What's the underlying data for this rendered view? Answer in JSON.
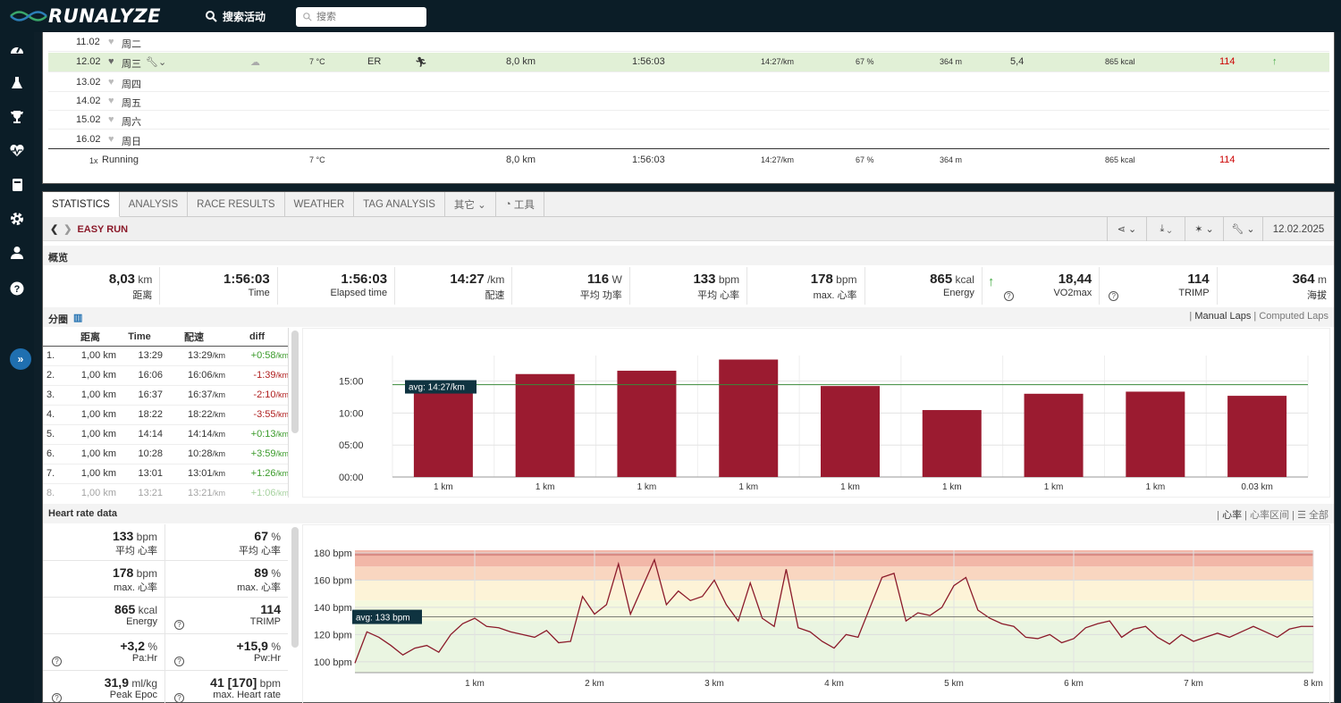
{
  "app": {
    "logo": "RUNALYZE",
    "search_activities": "搜索活动",
    "search_placeholder": "搜索"
  },
  "sidebar_icons": [
    "dashboard-icon",
    "flask-icon",
    "trophy-icon",
    "heartbeat-icon",
    "book-icon",
    "gear-icon",
    "user-icon",
    "help-icon"
  ],
  "week": {
    "rows": [
      {
        "date": "11.02",
        "day": "周二"
      },
      {
        "date": "12.02",
        "day": "周三",
        "temp": "7 °C",
        "type": "ER",
        "dist": "8,0 km",
        "time": "1:56:03",
        "pace": "14:27/km",
        "hrpct": "67 %",
        "elev": "364 m",
        "vo2": "5,4",
        "energy": "865 kcal",
        "trimp": "114"
      },
      {
        "date": "13.02",
        "day": "周四"
      },
      {
        "date": "14.02",
        "day": "周五"
      },
      {
        "date": "15.02",
        "day": "周六"
      },
      {
        "date": "16.02",
        "day": "周日"
      }
    ],
    "summary": {
      "count": "1x",
      "sport": "Running",
      "temp": "7 °C",
      "dist": "8,0 km",
      "time": "1:56:03",
      "pace": "14:27/km",
      "hrpct": "67 %",
      "elev": "364 m",
      "energy": "865 kcal",
      "trimp": "114"
    }
  },
  "tabs": [
    "STATISTICS",
    "ANALYSIS",
    "RACE RESULTS",
    "WEATHER",
    "TAG ANALYSIS",
    "其它",
    "工具"
  ],
  "activity": {
    "title": "EASY RUN",
    "date": "12.02.2025"
  },
  "overview": {
    "heading": "概览",
    "items": [
      {
        "value": "8,03",
        "unit": "km",
        "label": "距离"
      },
      {
        "value": "1:56:03",
        "unit": "",
        "label": "Time"
      },
      {
        "value": "1:56:03",
        "unit": "",
        "label": "Elapsed time"
      },
      {
        "value": "14:27",
        "unit": "/km",
        "label": "配速"
      },
      {
        "value": "116",
        "unit": "W",
        "label": "平均 功率"
      },
      {
        "value": "133",
        "unit": "bpm",
        "label": "平均 心率"
      },
      {
        "value": "178",
        "unit": "bpm",
        "label": "max. 心率"
      },
      {
        "value": "865",
        "unit": "kcal",
        "label": "Energy"
      },
      {
        "value": "18,44",
        "unit": "",
        "label": "VO2max"
      },
      {
        "value": "114",
        "unit": "",
        "label": "TRIMP"
      },
      {
        "value": "364",
        "unit": "m",
        "label": "海拔"
      }
    ]
  },
  "laps": {
    "heading": "分圈",
    "manual": "Manual Laps",
    "computed": "Computed Laps",
    "columns": [
      "距离",
      "Time",
      "配速",
      "diff"
    ],
    "rows": [
      {
        "n": "1.",
        "dist": "1,00 km",
        "time": "13:29",
        "pace": "13:29",
        "diff": "+0:58"
      },
      {
        "n": "2.",
        "dist": "1,00 km",
        "time": "16:06",
        "pace": "16:06",
        "diff": "-1:39"
      },
      {
        "n": "3.",
        "dist": "1,00 km",
        "time": "16:37",
        "pace": "16:37",
        "diff": "-2:10"
      },
      {
        "n": "4.",
        "dist": "1,00 km",
        "time": "18:22",
        "pace": "18:22",
        "diff": "-3:55"
      },
      {
        "n": "5.",
        "dist": "1,00 km",
        "time": "14:14",
        "pace": "14:14",
        "diff": "+0:13"
      },
      {
        "n": "6.",
        "dist": "1,00 km",
        "time": "10:28",
        "pace": "10:28",
        "diff": "+3:59"
      },
      {
        "n": "7.",
        "dist": "1,00 km",
        "time": "13:01",
        "pace": "13:01",
        "diff": "+1:26"
      },
      {
        "n": "8.",
        "dist": "1,00 km",
        "time": "13:21",
        "pace": "13:21",
        "diff": "+1:06"
      }
    ],
    "pace_unit": "/km",
    "diff_unit": "/km"
  },
  "chart_data": [
    {
      "type": "bar",
      "categories": [
        "1 km",
        "1 km",
        "1 km",
        "1 km",
        "1 km",
        "1 km",
        "1 km",
        "1 km",
        "0.03 km"
      ],
      "values": [
        13.48,
        16.1,
        16.62,
        18.37,
        14.23,
        10.47,
        13.02,
        13.35,
        12.7
      ],
      "ylim": [
        0,
        19
      ],
      "yticks": [
        "00:00",
        "05:00",
        "10:00",
        "15:00"
      ],
      "avg": 14.45,
      "avg_label": "avg: 14:27/km",
      "color": "#9b1b30"
    },
    {
      "type": "line",
      "x": [
        0,
        0.1,
        0.2,
        0.3,
        0.4,
        0.5,
        0.6,
        0.7,
        0.8,
        0.9,
        1.0,
        1.1,
        1.2,
        1.3,
        1.4,
        1.5,
        1.6,
        1.7,
        1.8,
        1.9,
        2.0,
        2.1,
        2.2,
        2.3,
        2.4,
        2.5,
        2.6,
        2.7,
        2.8,
        2.9,
        3.0,
        3.1,
        3.2,
        3.3,
        3.4,
        3.5,
        3.6,
        3.7,
        3.8,
        3.9,
        4.0,
        4.1,
        4.2,
        4.3,
        4.4,
        4.5,
        4.6,
        4.7,
        4.8,
        4.9,
        5.0,
        5.1,
        5.2,
        5.3,
        5.4,
        5.5,
        5.6,
        5.7,
        5.8,
        5.9,
        6.0,
        6.1,
        6.2,
        6.3,
        6.4,
        6.5,
        6.6,
        6.7,
        6.8,
        6.9,
        7.0,
        7.1,
        7.2,
        7.3,
        7.4,
        7.5,
        7.6,
        7.7,
        7.8,
        7.9,
        8.0
      ],
      "y": [
        99,
        122,
        118,
        112,
        105,
        110,
        112,
        107,
        120,
        128,
        132,
        126,
        125,
        122,
        120,
        118,
        123,
        114,
        115,
        148,
        135,
        142,
        172,
        135,
        155,
        175,
        142,
        152,
        145,
        148,
        160,
        142,
        130,
        158,
        132,
        126,
        168,
        125,
        122,
        115,
        110,
        120,
        118,
        140,
        162,
        165,
        130,
        136,
        134,
        140,
        156,
        162,
        138,
        132,
        128,
        126,
        118,
        117,
        120,
        114,
        117,
        125,
        128,
        130,
        118,
        124,
        126,
        118,
        113,
        120,
        115,
        118,
        121,
        118,
        122,
        126,
        122,
        118,
        124,
        126,
        126
      ],
      "xlabels": [
        "1 km",
        "2 km",
        "3 km",
        "4 km",
        "5 km",
        "6 km",
        "7 km",
        "8 km"
      ],
      "ylim": [
        92,
        182
      ],
      "yticks": [
        "100 bpm",
        "120 bpm",
        "140 bpm",
        "160 bpm",
        "180 bpm"
      ],
      "avg": 133,
      "avg_label": "avg: 133 bpm",
      "color": "#8b1a2a"
    }
  ],
  "hr": {
    "heading": "Heart rate data",
    "links": [
      "心率",
      "心率区间",
      "全部"
    ],
    "cells": [
      {
        "value": "133",
        "unit": "bpm",
        "label": "平均 心率"
      },
      {
        "value": "67",
        "unit": "%",
        "label": "平均 心率"
      },
      {
        "value": "178",
        "unit": "bpm",
        "label": "max. 心率"
      },
      {
        "value": "89",
        "unit": "%",
        "label": "max. 心率"
      },
      {
        "value": "865",
        "unit": "kcal",
        "label": "Energy"
      },
      {
        "value": "114",
        "unit": "",
        "label": "TRIMP"
      },
      {
        "value": "+3,2",
        "unit": "%",
        "label": "Pa:Hr"
      },
      {
        "value": "+15,9",
        "unit": "%",
        "label": "Pw:Hr"
      },
      {
        "value": "31,9",
        "unit": "ml/kg",
        "label": "Peak Epoc"
      },
      {
        "value": "41 [170]",
        "unit": "bpm",
        "label": "max. Heart rate"
      }
    ]
  }
}
